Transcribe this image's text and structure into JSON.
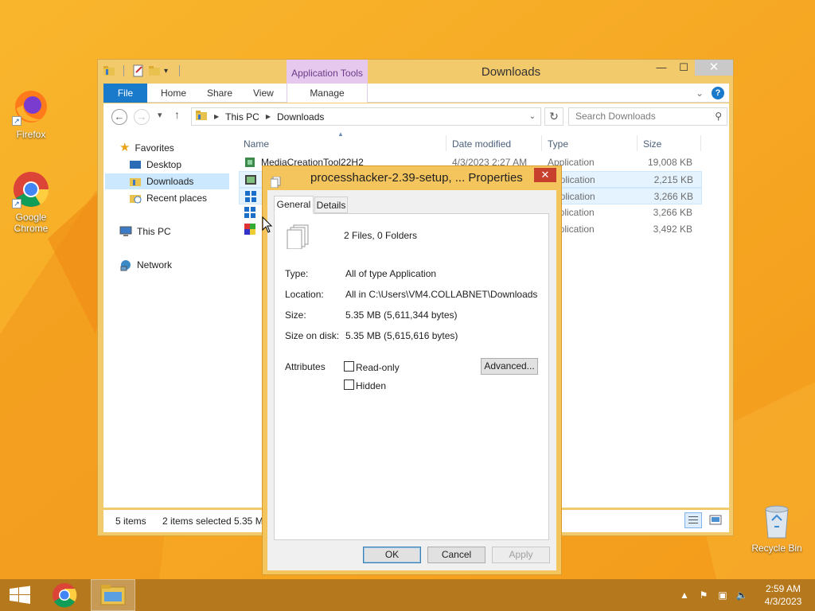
{
  "desktop": {
    "icons": [
      {
        "label": "Firefox"
      },
      {
        "label": "Google Chrome"
      }
    ],
    "recycle_bin": "Recycle Bin"
  },
  "explorer": {
    "title": "Downloads",
    "contextual_tab_group": "Application Tools",
    "ribbon_tabs": [
      "File",
      "Home",
      "Share",
      "View",
      "Manage"
    ],
    "address": {
      "crumbs": [
        "This PC",
        "Downloads"
      ],
      "search_placeholder": "Search Downloads"
    },
    "nav": {
      "favorites": "Favorites",
      "desktop": "Desktop",
      "downloads": "Downloads",
      "recent": "Recent places",
      "this_pc": "This PC",
      "network": "Network"
    },
    "columns": {
      "name": "Name",
      "date": "Date modified",
      "type": "Type",
      "size": "Size"
    },
    "files": [
      {
        "name": "MediaCreationTool22H2",
        "date": "4/3/2023 2:27 AM",
        "type": "Application",
        "size": "19,008 KB",
        "selected": false
      },
      {
        "name": "",
        "date": "",
        "type": "Application",
        "size": "2,215 KB",
        "selected": true
      },
      {
        "name": "",
        "date": "",
        "type": "Application",
        "size": "3,266 KB",
        "selected": true
      },
      {
        "name": "",
        "date": "",
        "type": "Application",
        "size": "3,266 KB",
        "selected": false
      },
      {
        "name": "",
        "date": "",
        "type": "Application",
        "size": "3,492 KB",
        "selected": false
      }
    ],
    "status": {
      "items": "5 items",
      "selected": "2 items selected",
      "size": "5.35 M"
    }
  },
  "properties": {
    "title": "processhacker-2.39-setup, ... Properties",
    "tabs": [
      "General",
      "Details"
    ],
    "summary": "2 Files, 0 Folders",
    "fields": {
      "type_label": "Type:",
      "type_value": "All of type Application",
      "location_label": "Location:",
      "location_value": "All in C:\\Users\\VM4.COLLABNET\\Downloads",
      "size_label": "Size:",
      "size_value": "5.35 MB (5,611,344 bytes)",
      "disk_label": "Size on disk:",
      "disk_value": "5.35 MB (5,615,616 bytes)"
    },
    "attributes_label": "Attributes",
    "readonly_label": "Read-only",
    "hidden_label": "Hidden",
    "advanced_label": "Advanced...",
    "ok_label": "OK",
    "cancel_label": "Cancel",
    "apply_label": "Apply"
  },
  "taskbar": {
    "time": "2:59 AM",
    "date": "4/3/2023"
  },
  "colors": {
    "accent": "#1979ca",
    "wallpaper": "#f7a31c"
  }
}
